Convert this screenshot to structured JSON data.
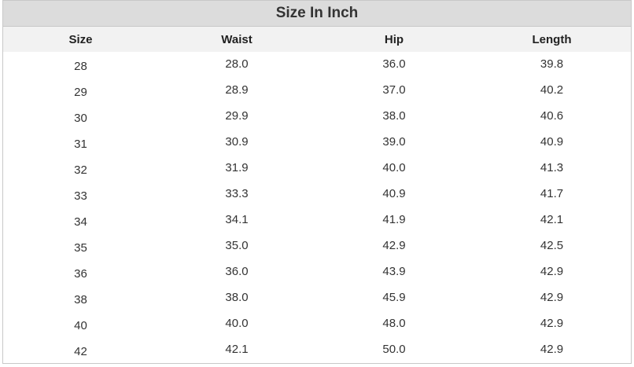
{
  "title": "Size In Inch",
  "columns": [
    "Size",
    "Waist",
    "Hip",
    "Length"
  ],
  "rows": [
    [
      "28",
      "28.0",
      "36.0",
      "39.8"
    ],
    [
      "29",
      "28.9",
      "37.0",
      "40.2"
    ],
    [
      "30",
      "29.9",
      "38.0",
      "40.6"
    ],
    [
      "31",
      "30.9",
      "39.0",
      "40.9"
    ],
    [
      "32",
      "31.9",
      "40.0",
      "41.3"
    ],
    [
      "33",
      "33.3",
      "40.9",
      "41.7"
    ],
    [
      "34",
      "34.1",
      "41.9",
      "42.1"
    ],
    [
      "35",
      "35.0",
      "42.9",
      "42.5"
    ],
    [
      "36",
      "36.0",
      "43.9",
      "42.9"
    ],
    [
      "38",
      "38.0",
      "45.9",
      "42.9"
    ],
    [
      "40",
      "40.0",
      "48.0",
      "42.9"
    ],
    [
      "42",
      "42.1",
      "50.0",
      "42.9"
    ]
  ]
}
